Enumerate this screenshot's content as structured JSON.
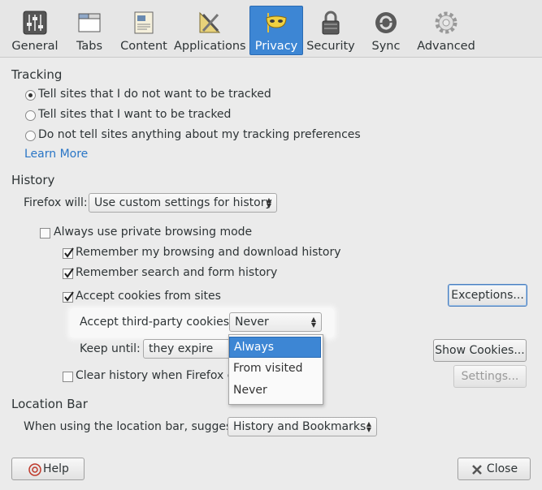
{
  "toolbar": {
    "tabs": [
      {
        "label": "General",
        "icon": "sliders-icon"
      },
      {
        "label": "Tabs",
        "icon": "tabs-icon"
      },
      {
        "label": "Content",
        "icon": "content-icon"
      },
      {
        "label": "Applications",
        "icon": "applications-icon"
      },
      {
        "label": "Privacy",
        "icon": "privacy-mask-icon",
        "active": true
      },
      {
        "label": "Security",
        "icon": "padlock-icon"
      },
      {
        "label": "Sync",
        "icon": "sync-icon"
      },
      {
        "label": "Advanced",
        "icon": "gear-icon"
      }
    ]
  },
  "tracking": {
    "heading": "Tracking",
    "options": [
      {
        "label": "Tell sites that I do not want to be tracked",
        "selected": true
      },
      {
        "label": "Tell sites that I want to be tracked",
        "selected": false
      },
      {
        "label": "Do not tell sites anything about my tracking preferences",
        "selected": false
      }
    ],
    "learn_more": "Learn More"
  },
  "history": {
    "heading": "History",
    "firefox_will_label": "Firefox will:",
    "firefox_will_value": "Use custom settings for history",
    "private_mode_label": "Always use private browsing mode",
    "private_mode_checked": false,
    "remember_browsing_label": "Remember my browsing and download history",
    "remember_browsing_checked": true,
    "remember_search_label": "Remember search and form history",
    "remember_search_checked": true,
    "accept_cookies_label": "Accept cookies from sites",
    "accept_cookies_checked": true,
    "exceptions_button": "Exceptions...",
    "third_party_label": "Accept third-party cookies:",
    "third_party_value": "Never",
    "third_party_options": [
      "Always",
      "From visited",
      "Never"
    ],
    "third_party_highlighted": "Always",
    "keep_until_label": "Keep until:",
    "keep_until_value": "they expire",
    "show_cookies_button": "Show Cookies...",
    "clear_history_label": "Clear history when Firefox closes",
    "clear_history_checked": false,
    "settings_button": "Settings..."
  },
  "location_bar": {
    "heading": "Location Bar",
    "suggest_label": "When using the location bar, suggest:",
    "suggest_value": "History and Bookmarks"
  },
  "footer": {
    "help_button": "Help",
    "close_button": "Close"
  },
  "colors": {
    "accent": "#3d86d4",
    "link": "#2a76c6",
    "background": "#ebebeb"
  }
}
